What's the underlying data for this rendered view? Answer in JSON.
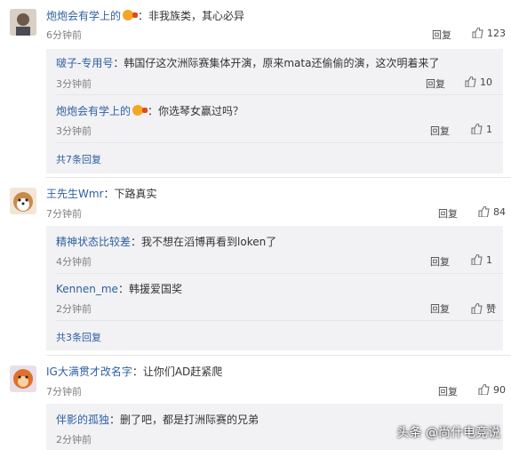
{
  "comments": [
    {
      "user": "炮炮会有学上的",
      "text": "：非我族类，其心必异",
      "time": "6分钟前",
      "reply_label": "回复",
      "likes": "123",
      "replies": [
        {
          "user": "啵子-专用号",
          "text": "：韩国仔这次洲际赛集体开演，原来mata还偷偷的演，这次明着来了",
          "time": "3分钟前",
          "reply_label": "回复",
          "likes": "10"
        },
        {
          "user": "炮炮会有学上的",
          "text": "：你选琴女赢过吗？",
          "time": "3分钟前",
          "reply_label": "回复",
          "likes": "1"
        }
      ],
      "more": "共7条回复"
    },
    {
      "user": "王先生Wmr",
      "text": "：下路真实",
      "time": "7分钟前",
      "reply_label": "回复",
      "likes": "84",
      "replies": [
        {
          "user": "精神状态比较差",
          "text": "：我不想在滔博再看到loken了",
          "time": "4分钟前",
          "reply_label": "回复",
          "likes": "1"
        },
        {
          "user": "Kennen_me",
          "text": "：韩援爱国奖",
          "time": "2分钟前",
          "reply_label": "回复",
          "likes": "赞"
        }
      ],
      "more": "共3条回复"
    },
    {
      "user": "IG大满贯才改名字",
      "text": "：让你们AD赶紧爬",
      "time": "7分钟前",
      "reply_label": "回复",
      "likes": "90",
      "replies": [
        {
          "user": "伴影的孤独",
          "text": "：删了吧，都是打洲际赛的兄弟",
          "time": "2分钟前"
        }
      ]
    }
  ],
  "watermark": "头条 @尚什电竞说"
}
